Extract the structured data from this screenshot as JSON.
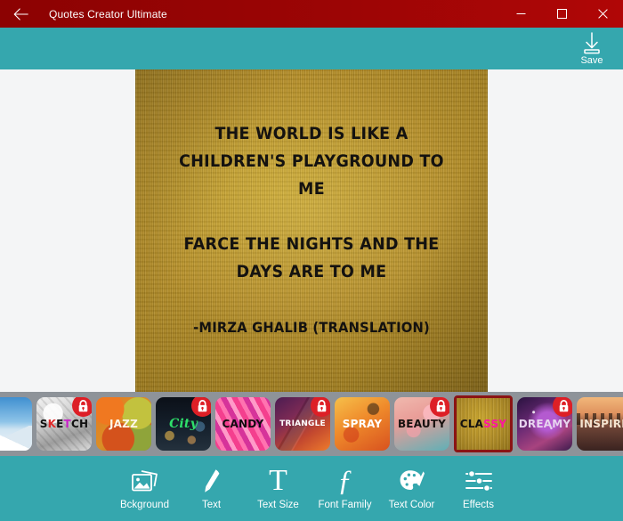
{
  "window": {
    "title": "Quotes Creator Ultimate",
    "back_icon": "back-arrow-icon",
    "minimize_icon": "minimize-icon",
    "maximize_icon": "maximize-icon",
    "close_icon": "close-icon",
    "titlebar_color": "#9c0505"
  },
  "header": {
    "save_label": "Save",
    "save_icon": "download-save-icon",
    "accent_color": "#35a7ae"
  },
  "canvas": {
    "background_style": "classy-gold-texture",
    "background_color": "#b08a20",
    "text_color": "#141210",
    "quote_lines": [
      "THE WORLD IS LIKE A",
      "CHILDREN'S PLAYGROUND TO",
      "ME"
    ],
    "quote_lines_2": [
      "FARCE THE NIGHTS AND THE",
      "DAYS ARE TO ME"
    ],
    "author": "-MIRZA GHALIB (TRANSLATION)"
  },
  "thumbnails": {
    "strip_background": "#8e9399",
    "selected_border_color": "#8b1414",
    "lock_badge_color": "#dd1f26",
    "items": [
      {
        "name": "mountain",
        "caption": "",
        "caption_color": "#ffffff",
        "locked": false,
        "selected": false,
        "art": "art-mountain",
        "partial": true
      },
      {
        "name": "sketch",
        "caption": "SKETCH",
        "caption_color": "#1a1a1a",
        "locked": true,
        "selected": false,
        "art": "art-sketch",
        "partial": false
      },
      {
        "name": "jazz",
        "caption": "JAZZ",
        "caption_color": "#fdf6e8",
        "locked": false,
        "selected": false,
        "art": "art-jazz",
        "partial": false
      },
      {
        "name": "city",
        "caption": "City",
        "caption_color": "#2ee06a",
        "locked": true,
        "selected": false,
        "art": "art-city",
        "partial": false
      },
      {
        "name": "candy",
        "caption": "CANDY",
        "caption_color": "#120a10",
        "locked": false,
        "selected": false,
        "art": "art-candy",
        "partial": false
      },
      {
        "name": "triangle",
        "caption": "TRIANGLE",
        "caption_color": "#ffffff",
        "locked": true,
        "selected": false,
        "art": "art-triangle",
        "partial": false
      },
      {
        "name": "spray",
        "caption": "SPRAY",
        "caption_color": "#ffffff",
        "locked": false,
        "selected": false,
        "art": "art-spray",
        "partial": false
      },
      {
        "name": "beauty",
        "caption": "BEAUTY",
        "caption_color": "#16100e",
        "locked": true,
        "selected": false,
        "art": "art-beauty",
        "partial": false
      },
      {
        "name": "classy",
        "caption": "CLASSY",
        "caption_color": "#141210",
        "locked": false,
        "selected": true,
        "art": "art-classy",
        "partial": false
      },
      {
        "name": "dreamy",
        "caption": "DREAMY",
        "caption_color": "#e7d4ef",
        "locked": true,
        "selected": false,
        "art": "art-dreamy",
        "partial": false
      },
      {
        "name": "inspire",
        "caption": "INSPIRE",
        "caption_color": "#f4e3cf",
        "locked": false,
        "selected": false,
        "art": "art-inspire",
        "partial": true
      }
    ]
  },
  "toolbar": {
    "items": [
      {
        "label": "Bckground",
        "icon": "images-stack-icon"
      },
      {
        "label": "Text",
        "icon": "pen-icon"
      },
      {
        "label": "Text Size",
        "icon": "letter-t-icon"
      },
      {
        "label": "Font Family",
        "icon": "script-f-icon"
      },
      {
        "label": "Text Color",
        "icon": "palette-icon"
      },
      {
        "label": "Effects",
        "icon": "sliders-icon"
      }
    ]
  }
}
